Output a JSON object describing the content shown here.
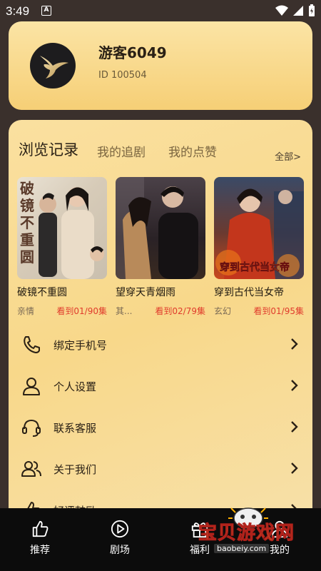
{
  "status_bar": {
    "time": "3:49",
    "notification_letter": "A"
  },
  "profile": {
    "username": "游客6049",
    "user_id": "ID  100504",
    "avatar_icon": "swallow-bird-icon"
  },
  "tabs": [
    {
      "label": "浏览记录",
      "active": true
    },
    {
      "label": "我的追剧",
      "active": false
    },
    {
      "label": "我的点赞",
      "active": false
    }
  ],
  "all_link": "全部>",
  "shows": [
    {
      "title": "破镜不重圆",
      "genre": "亲情",
      "progress": "看到01/90集",
      "poster_text": "破镜不重圆"
    },
    {
      "title": "望穿天青烟雨",
      "genre": "其...",
      "progress": "看到02/79集"
    },
    {
      "title": "穿到古代当女帝",
      "genre": "玄幻",
      "progress": "看到01/95集",
      "poster_text": "穿到古代当女帝"
    }
  ],
  "menu": [
    {
      "label": "绑定手机号",
      "icon": "phone-icon"
    },
    {
      "label": "个人设置",
      "icon": "user-icon"
    },
    {
      "label": "联系客服",
      "icon": "headset-icon"
    },
    {
      "label": "关于我们",
      "icon": "group-icon"
    },
    {
      "label": "好评鼓励",
      "icon": "thumbs-up-icon"
    }
  ],
  "bottom_nav": [
    {
      "label": "推荐",
      "icon": "thumbs-up-icon"
    },
    {
      "label": "剧场",
      "icon": "play-circle-icon"
    },
    {
      "label": "福利",
      "icon": "gift-icon"
    },
    {
      "label": "我的",
      "icon": "user-icon"
    }
  ],
  "watermark": {
    "text": "宝贝游戏网",
    "url": "baobeiy.com"
  },
  "colors": {
    "accent_red": "#e03b2c",
    "card_gold": "#f8d88a",
    "nav_bg": "#0c0c0c"
  }
}
